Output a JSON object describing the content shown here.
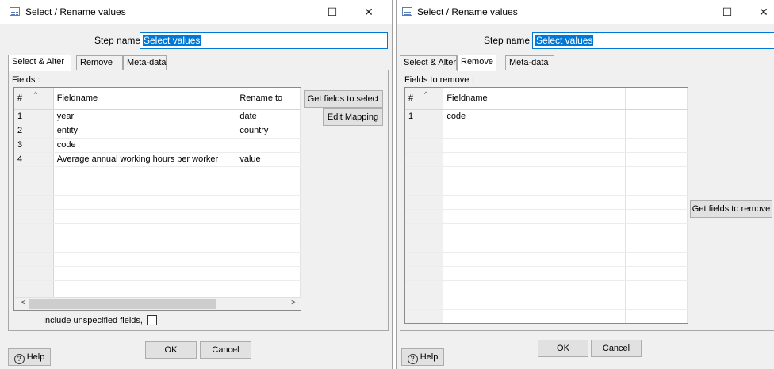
{
  "left_window": {
    "title": "Select / Rename values",
    "controls": {
      "minimize": "–",
      "maximize": "☐",
      "close": "✕"
    },
    "step_name_label": "Step name",
    "step_name_value": "Select values",
    "tabs": [
      {
        "label": "Select & Alter",
        "active": true
      },
      {
        "label": "Remove",
        "active": false
      },
      {
        "label": "Meta-data",
        "active": false
      }
    ],
    "fields_label": "Fields :",
    "table": {
      "columns": [
        "#",
        "Fieldname",
        "Rename to"
      ],
      "rows": [
        [
          "1",
          "year",
          "date"
        ],
        [
          "2",
          "entity",
          "country"
        ],
        [
          "3",
          "code",
          ""
        ],
        [
          "4",
          "Average annual working hours per worker",
          "value"
        ]
      ]
    },
    "get_fields_button": "Get fields to select",
    "edit_mapping_button": "Edit Mapping",
    "include_unspecified_label": "Include unspecified fields,",
    "include_unspecified_checked": false,
    "ok_button": "OK",
    "cancel_button": "Cancel",
    "help_button": "Help",
    "scroll_left": "<",
    "scroll_right": ">"
  },
  "right_window": {
    "title": "Select / Rename values",
    "controls": {
      "minimize": "–",
      "maximize": "☐",
      "close": "✕"
    },
    "step_name_label": "Step name",
    "step_name_value": "Select values",
    "tabs": [
      {
        "label": "Select & Alter",
        "active": false
      },
      {
        "label": "Remove",
        "active": true
      },
      {
        "label": "Meta-data",
        "active": false
      }
    ],
    "fields_label": "Fields to remove :",
    "table": {
      "columns": [
        "#",
        "Fieldname"
      ],
      "rows": [
        [
          "1",
          "code"
        ]
      ]
    },
    "get_fields_button": "Get fields to remove",
    "ok_button": "OK",
    "cancel_button": "Cancel",
    "help_button": "Help"
  },
  "icons": {
    "app": "dialog-icon",
    "help": "help-icon",
    "sort": "sort-caret-icon"
  }
}
